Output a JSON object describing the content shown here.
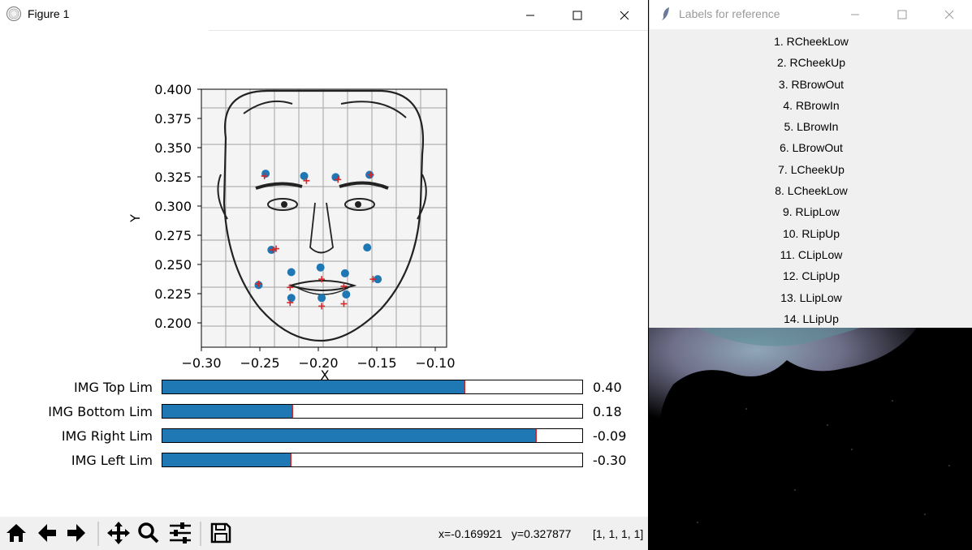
{
  "figure_window": {
    "title": "Figure 1",
    "controls": {
      "minimize": "—",
      "maximize": "☐",
      "close": "✕"
    }
  },
  "labels_window": {
    "title": "Labels for reference",
    "controls": {
      "minimize": "—",
      "maximize": "☐",
      "close": "✕"
    },
    "items": [
      "1. RCheekLow",
      "2. RCheekUp",
      "3. RBrowOut",
      "4. RBrowIn",
      "5. LBrowIn",
      "6. LBrowOut",
      "7. LCheekUp",
      "8. LCheekLow",
      "9. RLipLow",
      "10. RLipUp",
      "11. CLipLow",
      "12. CLipUp",
      "13. LLipLow",
      "14. LLipUp"
    ]
  },
  "chart_data": {
    "type": "scatter",
    "xlabel": "X",
    "ylabel": "Y",
    "xlim": [
      -0.3,
      -0.09
    ],
    "ylim": [
      0.18,
      0.4
    ],
    "xticks": [
      "−0.30",
      "−0.25",
      "−0.20",
      "−0.15",
      "−0.10"
    ],
    "yticks": [
      "0.400",
      "0.375",
      "0.350",
      "0.325",
      "0.300",
      "0.275",
      "0.250",
      "0.225",
      "0.200"
    ],
    "series": [
      {
        "marker": "circle",
        "color": "#1f77b4",
        "x": [
          -0.251,
          -0.24,
          -0.245,
          -0.212,
          -0.185,
          -0.156,
          -0.158,
          -0.149,
          -0.223,
          -0.223,
          -0.198,
          -0.197,
          -0.176,
          -0.177
        ],
        "y": [
          0.233,
          0.263,
          0.328,
          0.326,
          0.325,
          0.327,
          0.265,
          0.238,
          0.244,
          0.222,
          0.248,
          0.222,
          0.225,
          0.243
        ]
      },
      {
        "marker": "plus",
        "color": "#d62728",
        "x": [
          -0.251,
          -0.239,
          -0.246,
          -0.21,
          -0.183,
          -0.155,
          -0.236,
          -0.153,
          -0.224,
          -0.224,
          -0.197,
          -0.197,
          -0.178,
          -0.178
        ],
        "y": [
          0.234,
          0.263,
          0.326,
          0.322,
          0.323,
          0.327,
          0.264,
          0.238,
          0.218,
          0.231,
          0.215,
          0.238,
          0.217,
          0.232
        ]
      }
    ]
  },
  "sliders": [
    {
      "label": "IMG Top Lim",
      "value": "0.40",
      "fraction": 0.72
    },
    {
      "label": "IMG Bottom Lim",
      "value": "0.18",
      "fraction": 0.31
    },
    {
      "label": "IMG Right Lim",
      "value": "-0.09",
      "fraction": 0.89
    },
    {
      "label": "IMG Left Lim",
      "value": "-0.30",
      "fraction": 0.305
    }
  ],
  "toolbar": {
    "coords": "x=-0.169921   y=0.327877",
    "dims": "[1, 1, 1, 1]"
  },
  "colors": {
    "slider_fill": "#1f77b4",
    "handle": "#d62728",
    "point": "#1f77b4",
    "marker": "#d62728"
  }
}
